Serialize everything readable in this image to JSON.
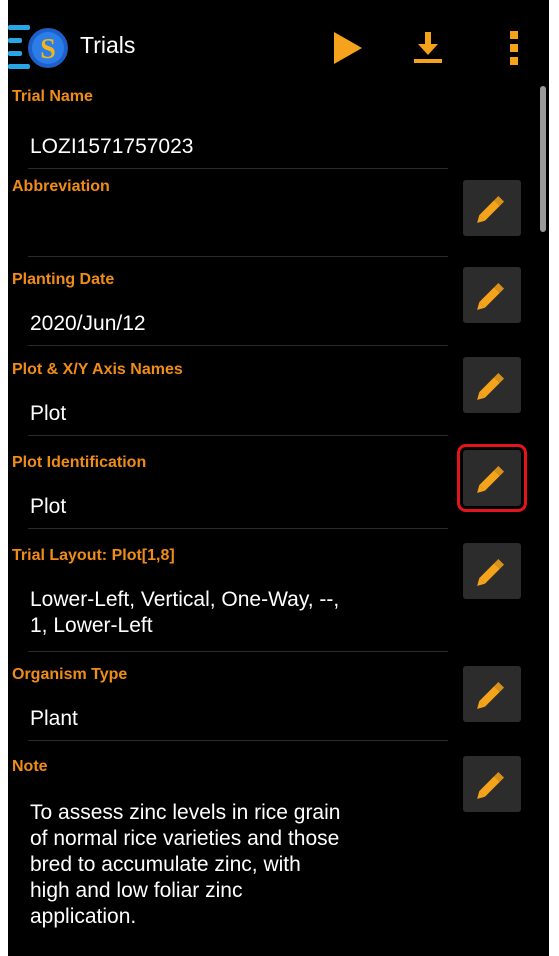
{
  "app_bar": {
    "title": "Trials",
    "actions": [
      "play-icon",
      "download-icon",
      "more-vert-icon"
    ]
  },
  "fields": [
    {
      "label": "Trial Name",
      "value": "LOZI1571757023",
      "editable": false
    },
    {
      "label": "Abbreviation",
      "value": "",
      "editable": true
    },
    {
      "label": "Planting Date",
      "value": "2020/Jun/12",
      "editable": true
    },
    {
      "label": "Plot & X/Y Axis Names",
      "value": "Plot",
      "editable": true
    },
    {
      "label": "Plot Identification",
      "value": "Plot",
      "editable": true,
      "highlighted": true
    },
    {
      "label": "Trial Layout: Plot[1,8]",
      "value_lines": [
        "Lower-Left, Vertical, One-Way, --,",
        "1, Lower-Left"
      ],
      "editable": true
    },
    {
      "label": "Organism Type",
      "value": "Plant",
      "editable": true
    },
    {
      "label": "Note",
      "value_lines": [
        "To assess zinc levels in rice grain",
        "of normal rice varieties and those",
        "bred to accumulate zinc, with",
        "high and low foliar zinc",
        "application."
      ],
      "editable": true
    }
  ],
  "colors": {
    "background": "#000000",
    "label": "#f08c18",
    "accent": "#f5a31a",
    "highlight": "#e3151b"
  }
}
